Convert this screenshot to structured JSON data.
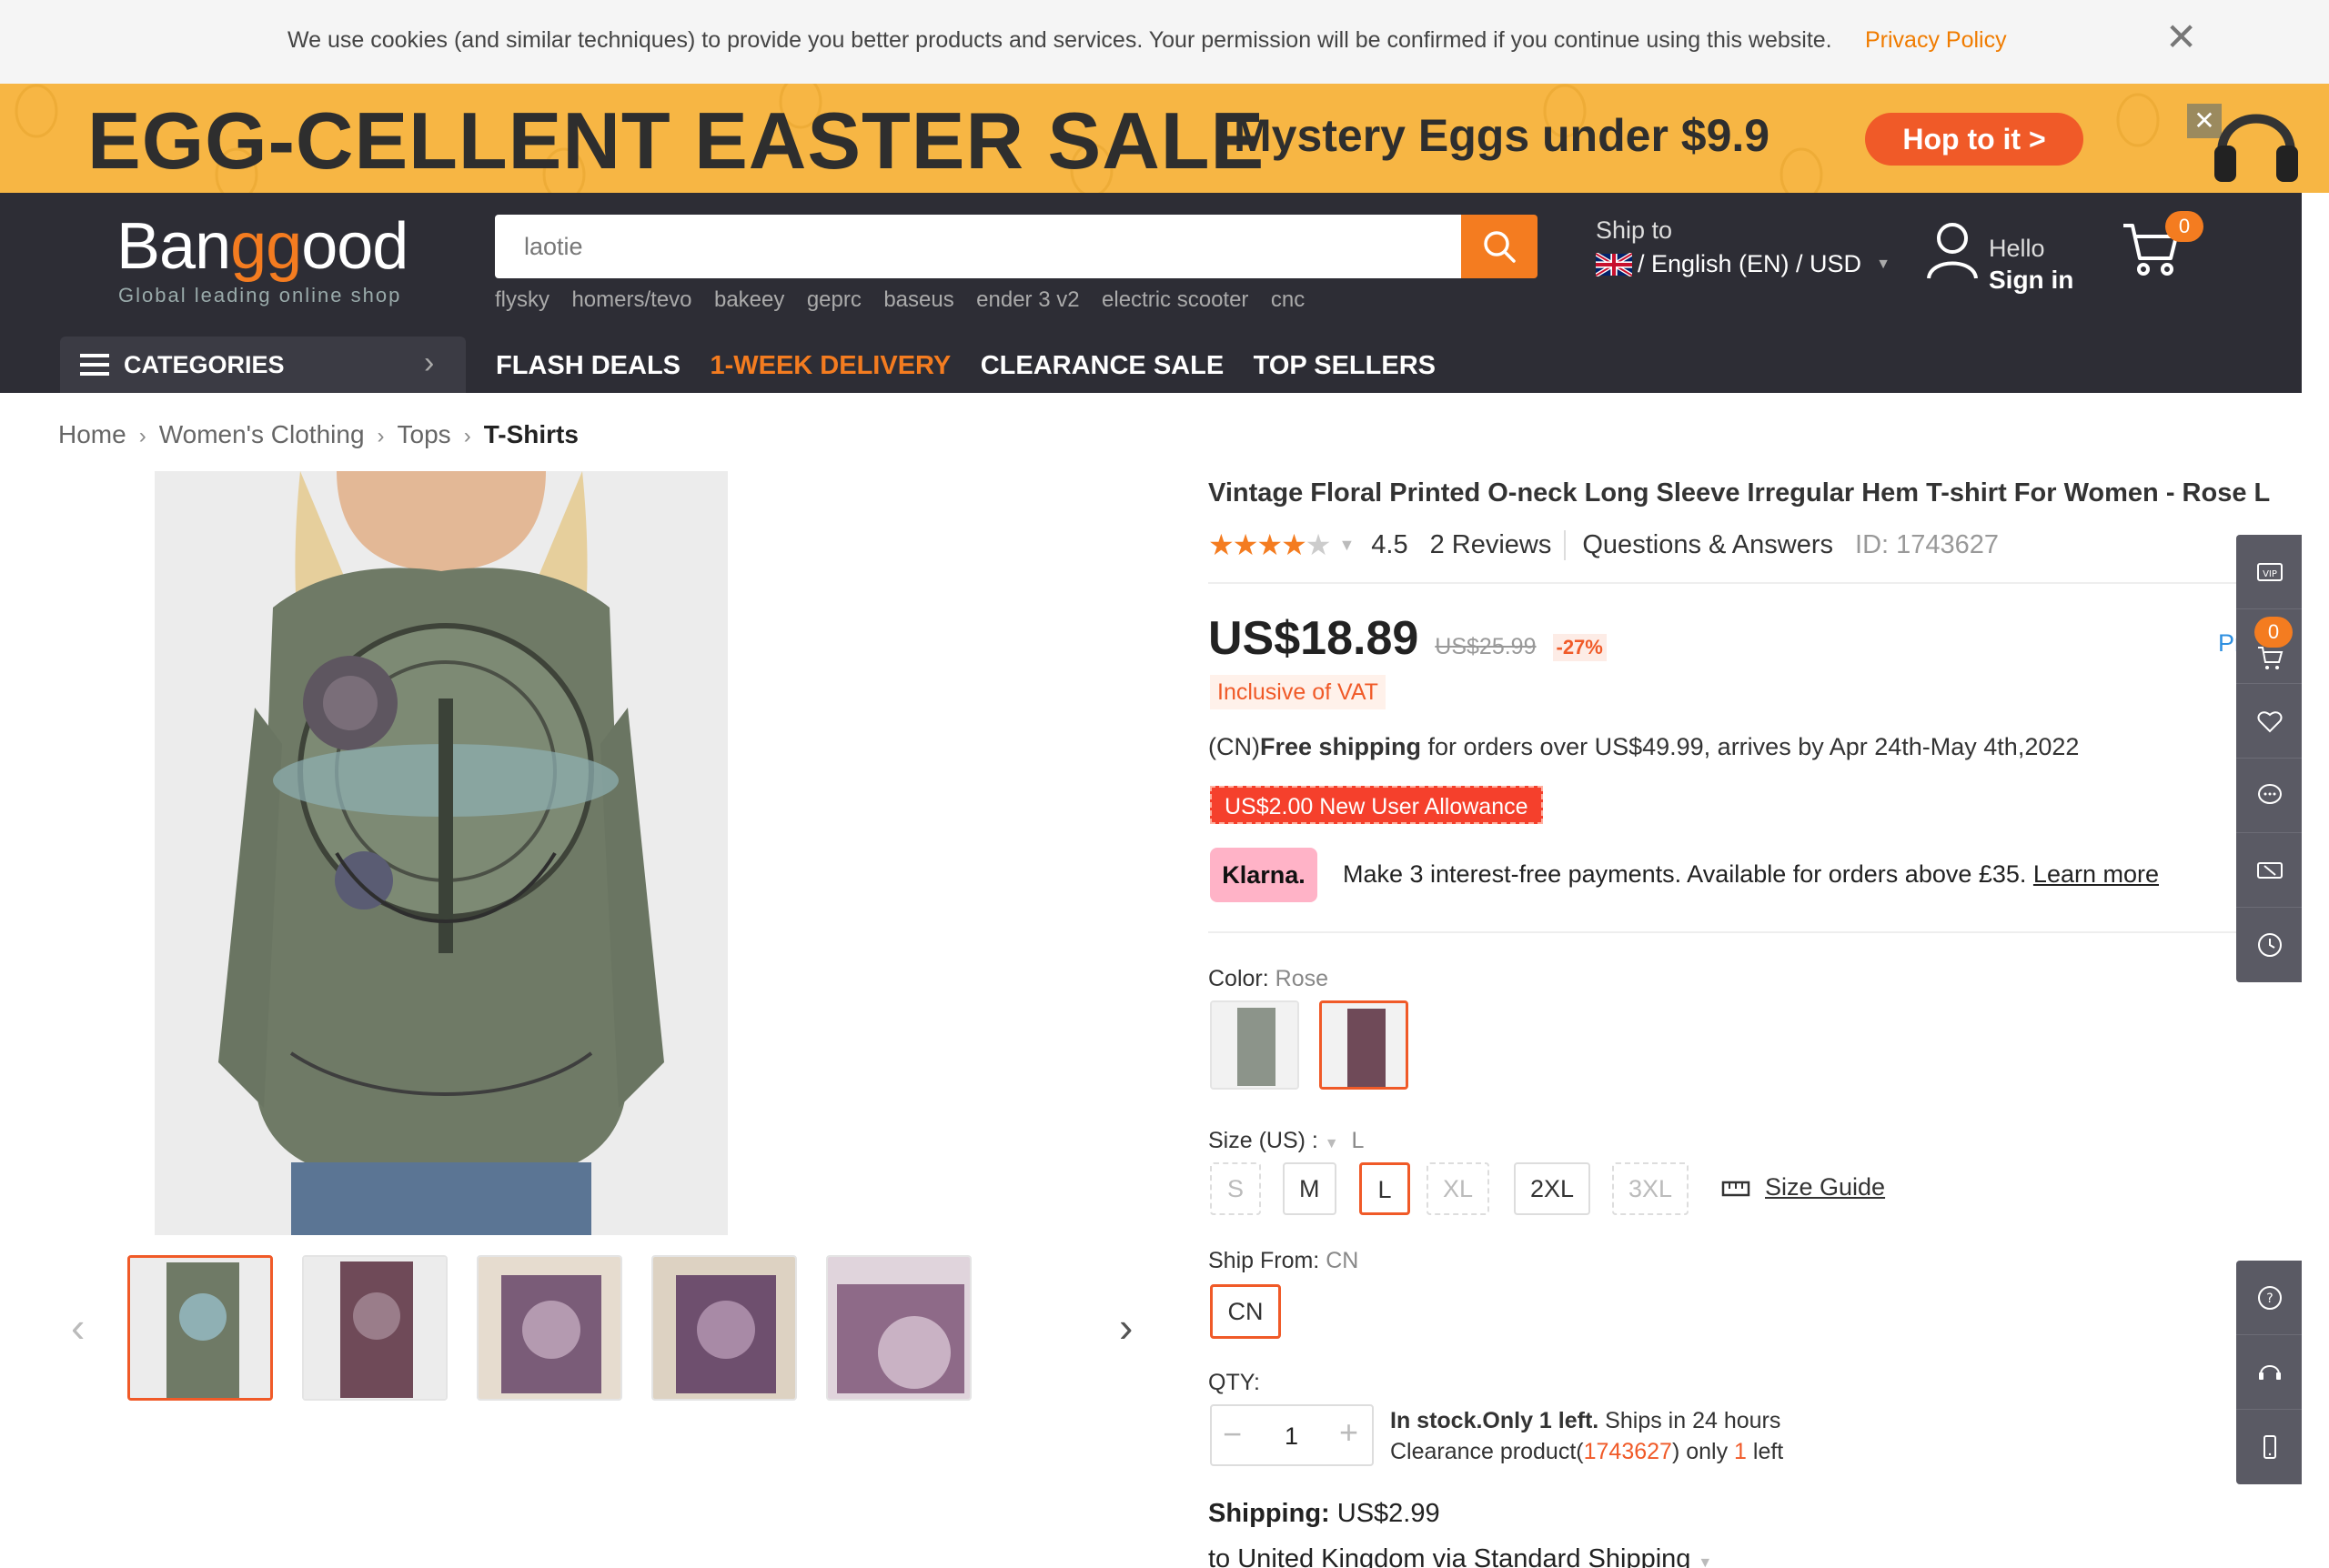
{
  "cookie": {
    "text": "We use cookies (and similar techniques) to provide you better products and services. Your permission will be confirmed if you continue using this website.",
    "link": "Privacy Policy",
    "close": "✕"
  },
  "banner": {
    "title": "EGG-CELLENT EASTER SALE",
    "subtitle": "Mystery Eggs under $9.9",
    "cta": "Hop to it >",
    "close": "✕"
  },
  "header": {
    "logo_a": "Ban",
    "logo_b": "gg",
    "logo_c": "ood",
    "tagline": "Global leading online shop",
    "search_value": "laotie",
    "hot_words": [
      "flysky",
      "homers/tevo",
      "bakeey",
      "geprc",
      "baseus",
      "ender 3 v2",
      "electric scooter",
      "cnc"
    ],
    "ship_label": "Ship to",
    "ship_lang": "/ English (EN) / USD",
    "hello": "Hello",
    "signin": "Sign in",
    "cart_count": "0"
  },
  "nav": {
    "categories": "CATEGORIES",
    "links": [
      "FLASH DEALS",
      "1-WEEK DELIVERY",
      "CLEARANCE SALE",
      "TOP SELLERS"
    ]
  },
  "breadcrumb": [
    "Home",
    "Women's Clothing",
    "Tops",
    "T-Shirts"
  ],
  "product": {
    "title": "Vintage Floral Printed O-neck Long Sleeve Irregular Hem T-shirt For Women - Rose L",
    "rating": "4.5",
    "rating_value": 4.5,
    "reviews": "2 Reviews",
    "qa": "Questions & Answers",
    "id": "ID: 1743627",
    "price": "US$18.89",
    "old_price": "US$25.99",
    "discount": "-27%",
    "vat": "Inclusive of VAT",
    "shipping_prefix": "(CN)",
    "shipping_bold": "Free shipping",
    "shipping_rest": " for orders over US$49.99, arrives by Apr 24th-May 4th,2022",
    "allowance": "US$2.00 New User Allowance",
    "klarna_badge": "Klarna.",
    "klarna_text": "Make 3 interest-free payments. Available for orders above £35. ",
    "klarna_link": "Learn more",
    "color_label": "Color: ",
    "color_value": "Rose",
    "size_label": "Size (US) : ",
    "size_value": "L",
    "sizes": [
      "S",
      "M",
      "L",
      "XL",
      "2XL",
      "3XL"
    ],
    "size_guide": "Size Guide",
    "ship_from_label": "Ship From: ",
    "ship_from_value": "CN",
    "ship_from_option": "CN",
    "qty_label": "QTY:",
    "qty": "1",
    "qty_minus": "−",
    "qty_plus": "+",
    "stock_bold": "In stock.Only 1 left.",
    "stock_rest": " Ships in 24 hours",
    "clearance_a": "Clearance product(",
    "clearance_id": "1743627",
    "clearance_b": ") only ",
    "clearance_n": "1",
    "clearance_c": " left",
    "shipping_cost_label": "Shipping:",
    "shipping_cost": " US$2.99",
    "ship_method": "to United Kingdom via Standard Shipping"
  },
  "float": {
    "cart_count": "0",
    "partial_link": "Pr       ert"
  },
  "colors": {
    "accent": "#f47c20",
    "header_bg": "#2d2d35",
    "banner_bg": "#f7b644"
  }
}
